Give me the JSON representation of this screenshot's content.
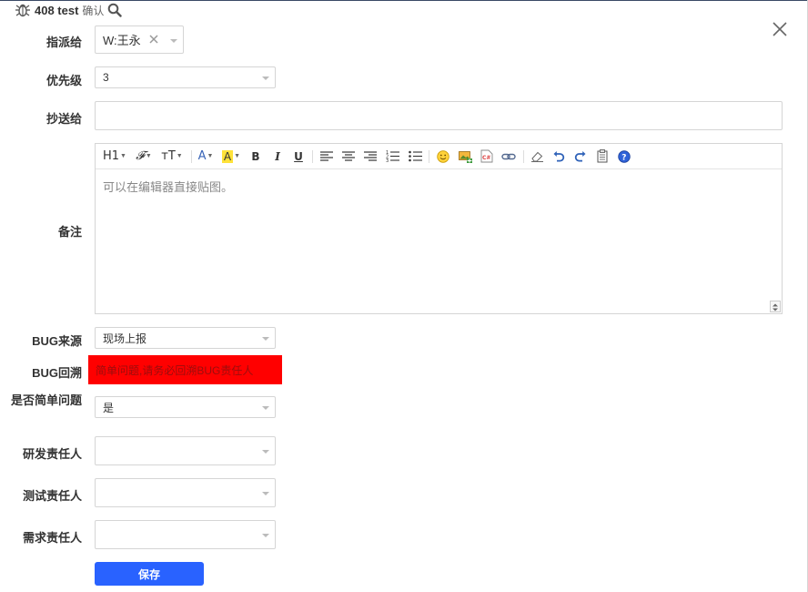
{
  "header": {
    "title": "408 test",
    "subtitle": "确认"
  },
  "icons": {
    "bug": "bug-icon",
    "search": "search-icon",
    "close": "close-icon"
  },
  "form": {
    "assign_label": "指派给",
    "assign_value": "W:王永",
    "priority_label": "优先级",
    "priority_value": "3",
    "cc_label": "抄送给",
    "cc_value": "",
    "remark_label": "备注",
    "editor_placeholder": "可以在编辑器直接贴图。",
    "toolbar": {
      "h1": "H1",
      "font": "𝓕",
      "size": "ᴛT",
      "color": "A",
      "bgcolor": "A",
      "bold": "B",
      "italic": "I",
      "underline": "U"
    },
    "bug_source_label": "BUG来源",
    "bug_source_value": "现场上报",
    "bug_trace_label": "BUG回溯",
    "bug_trace_warning": "简单问题,请务必回溯BUG责任人",
    "simple_label": "是否简单问题",
    "simple_value": "是",
    "dev_owner_label": "研发责任人",
    "test_owner_label": "测试责任人",
    "req_owner_label": "需求责任人",
    "save_label": "保存"
  },
  "colors": {
    "primary": "#2962ff",
    "warning_bg": "#ff0000",
    "warning_text": "#9b0d0d"
  }
}
